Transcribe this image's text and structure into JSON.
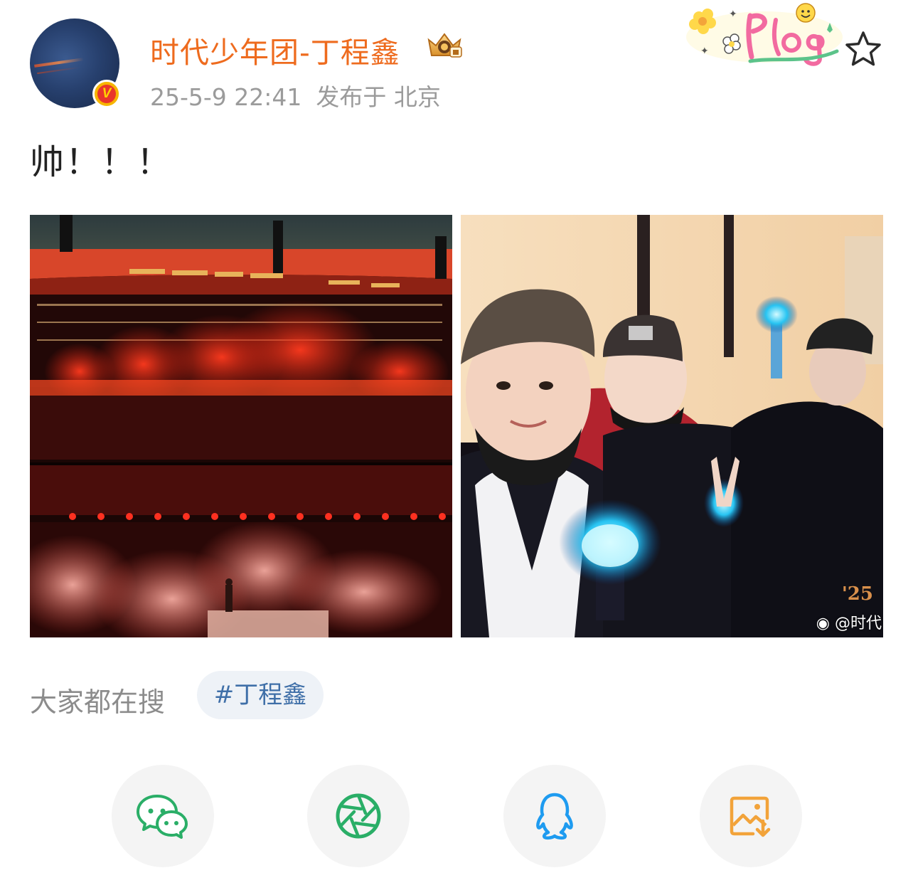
{
  "post": {
    "username": "时代少年团-丁程鑫",
    "date": "25-5-9 22:41",
    "location": "发布于 北京",
    "text": "帅！！！"
  },
  "badges": {
    "verified_mark": "V",
    "vip_icon": "crown-vip-icon",
    "sticker_icon": "plog-sticker-icon"
  },
  "photos": [
    {
      "alt": "stadium-concert-red-stage",
      "icon": "photo"
    },
    {
      "alt": "selfie-with-lightsticks",
      "icon": "photo",
      "year_mark": "'25",
      "watermark": "@时代"
    }
  ],
  "trending": {
    "label": "大家都在搜",
    "hashtag": "#丁程鑫"
  },
  "share": [
    {
      "target": "wechat",
      "icon": "wechat-icon",
      "color": "#2aae67"
    },
    {
      "target": "moments",
      "icon": "moments-shutter-icon",
      "color": "#2aae67"
    },
    {
      "target": "qq",
      "icon": "qq-penguin-icon",
      "color": "#1e9bf0"
    },
    {
      "target": "save-image",
      "icon": "save-image-icon",
      "color": "#f2a33a"
    }
  ],
  "colors": {
    "username": "#ee6b1e",
    "meta": "#9b9b9b",
    "hashtag_text": "#3f6fa8",
    "hashtag_bg": "#eef2f7",
    "verified_badge": "#f7b500"
  }
}
